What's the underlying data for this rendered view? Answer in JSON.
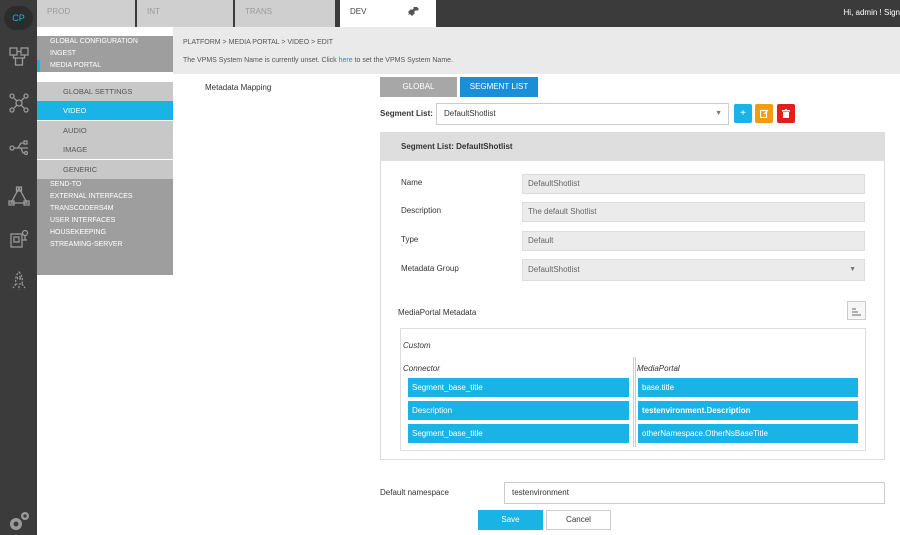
{
  "rail": {
    "logo": "CP",
    "icons": [
      "cube-network-icon",
      "nodes-icon",
      "usb-icon",
      "triangle-network-icon",
      "device-icon",
      "rocket-icon",
      "gears-icon"
    ]
  },
  "environments": [
    "PROD",
    "INT",
    "TRANS",
    "DEV"
  ],
  "active_environment": "DEV",
  "greeting": "Hi, admin ! Sign",
  "nav": {
    "items": [
      {
        "label": "GLOBAL CONFIGURATION",
        "level": "top"
      },
      {
        "label": "INGEST",
        "level": "top"
      },
      {
        "label": "MEDIA PORTAL",
        "level": "top"
      },
      {
        "label": "GLOBAL SETTINGS",
        "level": "sub"
      },
      {
        "label": "VIDEO",
        "level": "sub",
        "active": true
      },
      {
        "label": "AUDIO",
        "level": "sub"
      },
      {
        "label": "IMAGE",
        "level": "sub"
      },
      {
        "label": "GENERIC",
        "level": "sub"
      },
      {
        "label": "SEND-TO",
        "level": "top"
      },
      {
        "label": "EXTERNAL INTERFACES",
        "level": "top"
      },
      {
        "label": "TRANSCODERS4M",
        "level": "top"
      },
      {
        "label": "USER INTERFACES",
        "level": "top"
      },
      {
        "label": "HOUSEKEEPING",
        "level": "top"
      },
      {
        "label": "STREAMING-SERVER",
        "level": "top"
      }
    ]
  },
  "breadcrumb": "PLATFORM > MEDIA PORTAL > VIDEO > EDIT",
  "notice": {
    "before": "The VPMS System Name is currently unset. Click ",
    "link": "here",
    "after": " to set the VPMS System Name."
  },
  "section_label": "Metadata Mapping",
  "tabs": {
    "global": "GLOBAL",
    "segment_list": "SEGMENT LIST"
  },
  "segment_list": {
    "label": "Segment List:",
    "selected": "DefaultShotlist"
  },
  "panel": {
    "title": "Segment List: DefaultShotlist",
    "fields": {
      "name": {
        "label": "Name",
        "value": "DefaultShotlist"
      },
      "description": {
        "label": "Description",
        "value": "The default Shotlist"
      },
      "type": {
        "label": "Type",
        "value": "Default"
      },
      "metadata_group": {
        "label": "Metadata Group",
        "value": "DefaultShotlist"
      }
    },
    "metadata_title": "MediaPortal Metadata",
    "custom_label": "Custom",
    "col_connector": "Connector",
    "col_mediaportal": "MediaPortal",
    "rows": [
      {
        "connector": "Segment_base_title",
        "mediaportal": "base.title"
      },
      {
        "connector": "Description",
        "mediaportal": "testenvironment.Description"
      },
      {
        "connector": "Segment_base_title",
        "mediaportal": "otherNamespace.OtherNsBaseTitle"
      }
    ]
  },
  "default_namespace": {
    "label": "Default namespace",
    "value": "testenvironment"
  },
  "buttons": {
    "save": "Save",
    "cancel": "Cancel"
  },
  "colors": {
    "accent": "#19b3e6",
    "primary": "#1a8fd8",
    "warning": "#f39c12",
    "danger": "#e41d1d",
    "rail": "#3b3b3b"
  }
}
